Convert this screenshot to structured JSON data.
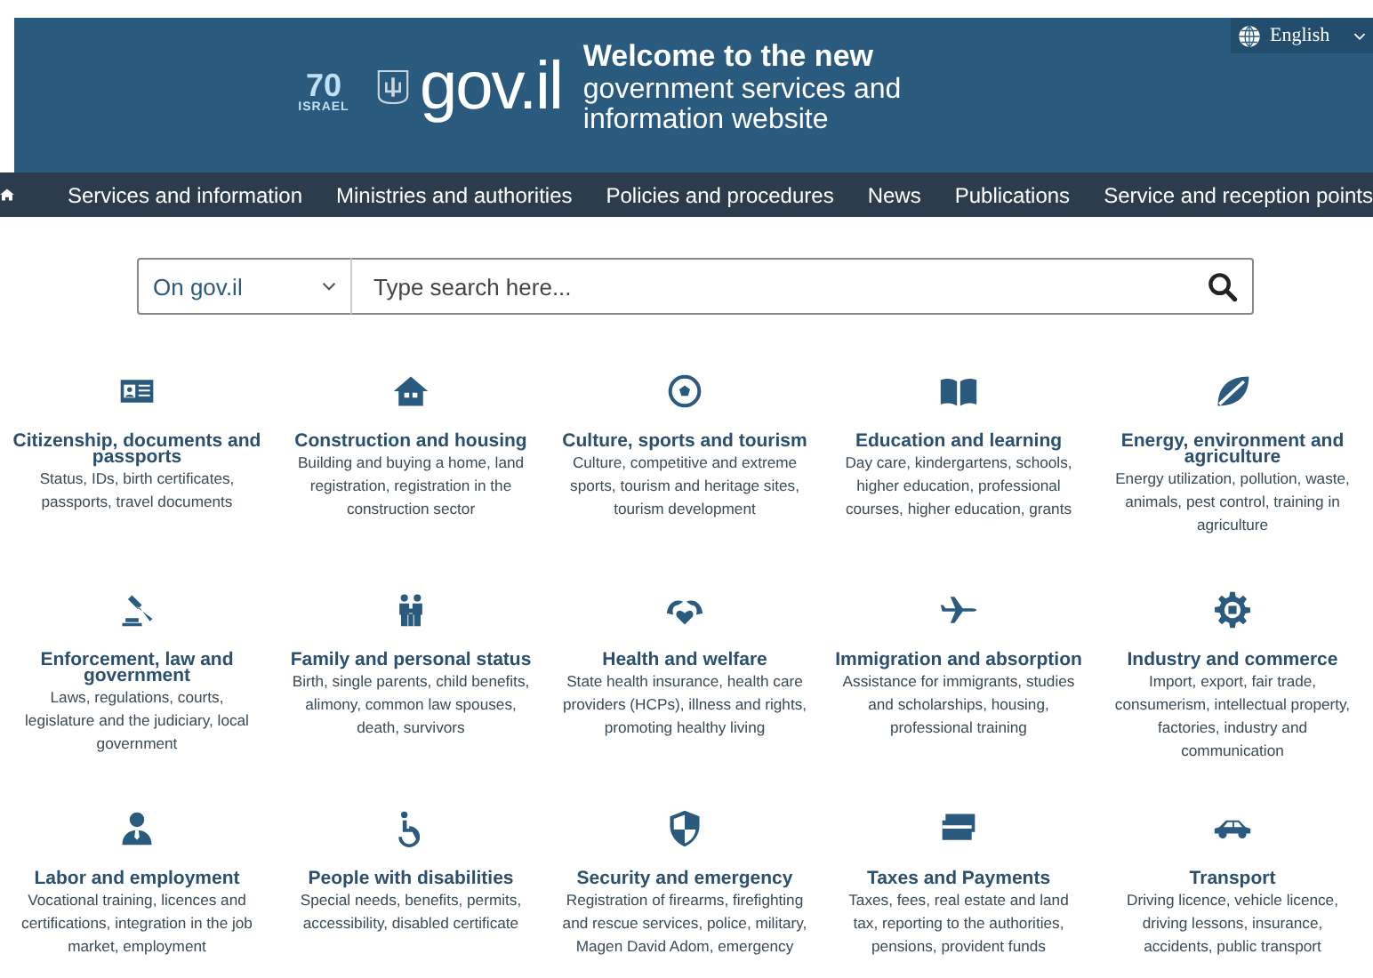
{
  "header": {
    "logo_badge": {
      "number": "70",
      "word": "ISRAEL"
    },
    "logo_text": "gov.il",
    "headline": "Welcome to the new",
    "subheadline": "government services and information website",
    "language": "English"
  },
  "nav": {
    "items": [
      {
        "label": "Services and information"
      },
      {
        "label": "Ministries and authorities"
      },
      {
        "label": "Policies and procedures"
      },
      {
        "label": "News"
      },
      {
        "label": "Publications"
      },
      {
        "label": "Service and reception points"
      }
    ]
  },
  "search": {
    "scope": "On gov.il",
    "placeholder": "Type search here..."
  },
  "categories": [
    {
      "title": "Citizenship, documents and passports",
      "description": "Status, IDs, birth certificates, passports, travel documents"
    },
    {
      "title": "Construction and housing",
      "description": "Building and buying a home, land registration, registration in the construction sector"
    },
    {
      "title": "Culture, sports and tourism",
      "description": "Culture, competitive and extreme sports, tourism and heritage sites, tourism development"
    },
    {
      "title": "Education and learning",
      "description": "Day care, kindergartens, schools, higher education, professional courses, higher education, grants"
    },
    {
      "title": "Energy, environment and agriculture",
      "description": "Energy utilization, pollution, waste, animals, pest control, training in agriculture"
    },
    {
      "title": "Enforcement, law and government",
      "description": "Laws, regulations, courts, legislature and the judiciary, local government"
    },
    {
      "title": "Family and personal status",
      "description": "Birth, single parents, child benefits, alimony, common law spouses, death, survivors"
    },
    {
      "title": "Health and welfare",
      "description": "State health insurance, health care providers (HCPs), illness and rights, promoting healthy living"
    },
    {
      "title": "Immigration and absorption",
      "description": "Assistance for immigrants, studies and scholarships, housing, professional training"
    },
    {
      "title": "Industry and commerce",
      "description": "Import, export, fair trade, consumerism, intellectual property, factories, industry and communication"
    },
    {
      "title": "Labor and employment",
      "description": "Vocational training, licences and certifications, integration in the job market, employment"
    },
    {
      "title": "People with disabilities",
      "description": "Special needs, benefits, permits, accessibility, disabled certificate"
    },
    {
      "title": "Security and emergency",
      "description": "Registration of firearms, firefighting and rescue services, police, military, Magen David Adom, emergency"
    },
    {
      "title": "Taxes and Payments",
      "description": "Taxes, fees, real estate and land tax, reporting to the authorities, pensions, provident funds"
    },
    {
      "title": "Transport",
      "description": "Driving licence, vehicle licence, driving lessons, insurance, accidents, public transport"
    }
  ]
}
